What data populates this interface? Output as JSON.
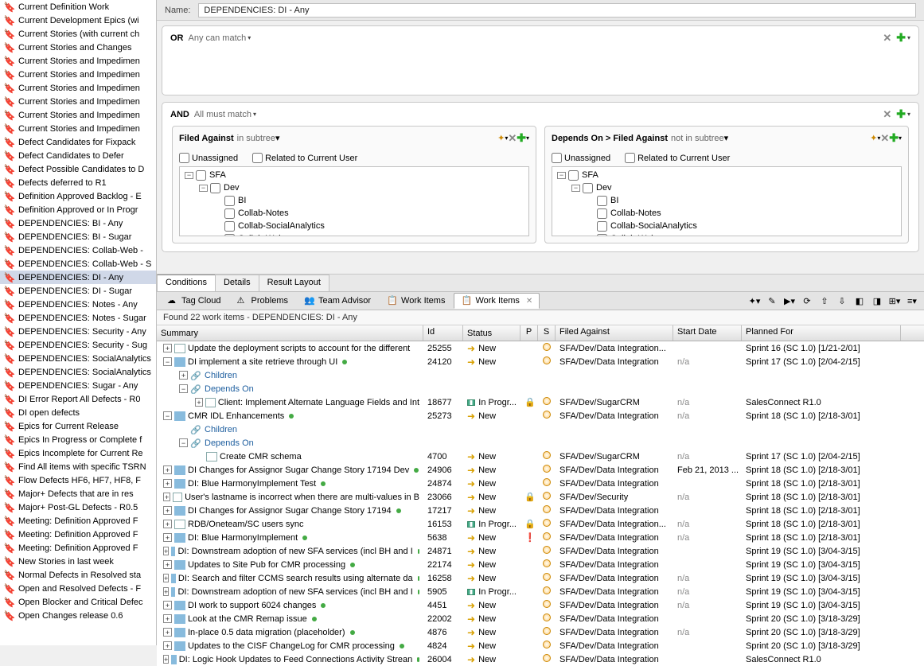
{
  "name_label": "Name:",
  "name_value": "DEPENDENCIES: DI - Any",
  "sidebar_items": [
    "Current Definition Work",
    "Current Development Epics (wi",
    "Current Stories (with current ch",
    "Current Stories and Changes",
    "Current Stories and Impedimen",
    "Current Stories and Impedimen",
    "Current Stories and Impedimen",
    "Current Stories and Impedimen",
    "Current Stories and Impedimen",
    "Current Stories and Impedimen",
    "Defect Candidates for Fixpack",
    "Defect Candidates to Defer",
    "Defect Possible Candidates to D",
    "Defects deferred to R1",
    "Definition Approved Backlog - E",
    "Definition Approved or In Progr",
    "DEPENDENCIES: BI - Any",
    "DEPENDENCIES: BI - Sugar",
    "DEPENDENCIES: Collab-Web - ",
    "DEPENDENCIES: Collab-Web - S",
    "DEPENDENCIES: DI - Any",
    "DEPENDENCIES: DI - Sugar",
    "DEPENDENCIES: Notes - Any",
    "DEPENDENCIES: Notes - Sugar",
    "DEPENDENCIES: Security - Any",
    "DEPENDENCIES: Security - Sug",
    "DEPENDENCIES: SocialAnalytics",
    "DEPENDENCIES: SocialAnalytics",
    "DEPENDENCIES: Sugar - Any",
    "DI Error Report All Defects - R0",
    "DI open defects",
    "Epics for Current Release",
    "Epics In Progress or Complete f",
    "Epics Incomplete for Current Re",
    "Find All items with specific TSRN",
    "Flow Defects HF6, HF7, HF8, F",
    "Major+ Defects  that are in res",
    "Major+ Post-GL Defects - R0.5",
    "Meeting:  Definition Approved F",
    "Meeting:  Definition Approved F",
    "Meeting:  Definition Approved F",
    "New Stories in last week",
    "Normal Defects in Resolved sta",
    "Open and Resolved Defects - F",
    "Open Blocker and Critical Defec",
    "Open Changes release 0.6"
  ],
  "sidebar_selected_index": 20,
  "or_block": {
    "label": "OR",
    "sub": "Any can match"
  },
  "and_block": {
    "label": "AND",
    "sub": "All must match"
  },
  "filters": [
    {
      "name": "Filed Against",
      "type": "in subtree",
      "unassigned_label": "Unassigned",
      "related_label": "Related to Current User",
      "tree": [
        "SFA",
        "Dev",
        "BI",
        "Collab-Notes",
        "Collab-SocialAnalytics",
        "Collab-Web"
      ]
    },
    {
      "name": "Depends On > Filed Against",
      "type": "not in subtree",
      "unassigned_label": "Unassigned",
      "related_label": "Related to Current User",
      "tree": [
        "SFA",
        "Dev",
        "BI",
        "Collab-Notes",
        "Collab-SocialAnalytics",
        "Collab-Web"
      ]
    }
  ],
  "bottom_tabs": [
    "Conditions",
    "Details",
    "Result Layout"
  ],
  "bottom_tab_active": 0,
  "views": [
    "Tag Cloud",
    "Problems",
    "Team Advisor",
    "Work Items",
    "Work Items"
  ],
  "view_active": 4,
  "result_status": "Found 22 work items - DEPENDENCIES: DI - Any",
  "columns": [
    "Summary",
    "Id",
    "Status",
    "P",
    "S",
    "Filed Against",
    "Start Date",
    "Planned For"
  ],
  "rows": [
    {
      "exp": "+",
      "ind": 0,
      "ico": "doc",
      "summary": "Update the deployment scripts to account for the different",
      "id": "25255",
      "status": "New",
      "stico": "new",
      "p": "",
      "s": "circ",
      "filed": "SFA/Dev/Data Integration...",
      "start": "",
      "planned": "Sprint 16 (SC 1.0) [1/21-2/01]"
    },
    {
      "exp": "-",
      "ind": 0,
      "ico": "story",
      "summary": "DI implement a site retrieve through UI",
      "id": "24120",
      "status": "New",
      "stico": "new",
      "p": "",
      "s": "circ",
      "filed": "SFA/Dev/Data Integration",
      "start": "n/a",
      "planned": "Sprint 17 (SC 1.0) [2/04-2/15]"
    },
    {
      "exp": "+",
      "ind": 1,
      "child": "Children"
    },
    {
      "exp": "-",
      "ind": 1,
      "child": "Depends On"
    },
    {
      "exp": "+",
      "ind": 2,
      "ico": "doc",
      "summary": "Client: Implement Alternate Language Fields and Int",
      "id": "18677",
      "status": "In Progr...",
      "stico": "prog",
      "p": "lock",
      "s": "circ",
      "filed": "SFA/Dev/SugarCRM",
      "start": "n/a",
      "planned": "SalesConnect R1.0"
    },
    {
      "exp": "-",
      "ind": 0,
      "ico": "story",
      "summary": "CMR IDL Enhancements",
      "id": "25273",
      "status": "New",
      "stico": "new",
      "p": "",
      "s": "circ",
      "filed": "SFA/Dev/Data Integration",
      "start": "n/a",
      "planned": "Sprint 18 (SC 1.0) [2/18-3/01]"
    },
    {
      "exp": "",
      "ind": 1,
      "child": "Children"
    },
    {
      "exp": "-",
      "ind": 1,
      "child": "Depends On"
    },
    {
      "exp": "",
      "ind": 2,
      "ico": "doc",
      "summary": "Create CMR schema",
      "id": "4700",
      "status": "New",
      "stico": "new",
      "p": "",
      "s": "circ",
      "filed": "SFA/Dev/SugarCRM",
      "start": "n/a",
      "planned": "Sprint 17 (SC 1.0) [2/04-2/15]"
    },
    {
      "exp": "+",
      "ind": 0,
      "ico": "story",
      "summary": "DI Changes for Assignor Sugar Change Story 17194 Dev",
      "id": "24906",
      "status": "New",
      "stico": "new",
      "p": "",
      "s": "circ",
      "filed": "SFA/Dev/Data Integration",
      "start": "Feb 21, 2013 ...",
      "planned": "Sprint 18 (SC 1.0) [2/18-3/01]"
    },
    {
      "exp": "+",
      "ind": 0,
      "ico": "story",
      "summary": "DI: Blue HarmonyImplement Test",
      "id": "24874",
      "status": "New",
      "stico": "new",
      "p": "",
      "s": "circ",
      "filed": "SFA/Dev/Data Integration",
      "start": "",
      "planned": "Sprint 18 (SC 1.0) [2/18-3/01]"
    },
    {
      "exp": "+",
      "ind": 0,
      "ico": "doc",
      "summary": "User's lastname is incorrect when there are multi-values in B",
      "id": "23066",
      "status": "New",
      "stico": "new",
      "p": "lock",
      "s": "circ",
      "filed": "SFA/Dev/Security",
      "start": "n/a",
      "planned": "Sprint 18 (SC 1.0) [2/18-3/01]"
    },
    {
      "exp": "+",
      "ind": 0,
      "ico": "story",
      "summary": "DI Changes for Assignor Sugar Change Story 17194",
      "id": "17217",
      "status": "New",
      "stico": "new",
      "p": "",
      "s": "circ",
      "filed": "SFA/Dev/Data Integration",
      "start": "",
      "planned": "Sprint 18 (SC 1.0) [2/18-3/01]"
    },
    {
      "exp": "+",
      "ind": 0,
      "ico": "doc",
      "summary": "RDB/Oneteam/SC users sync",
      "id": "16153",
      "status": "In Progr...",
      "stico": "prog",
      "p": "lock",
      "s": "circ",
      "filed": "SFA/Dev/Data Integration...",
      "start": "n/a",
      "planned": "Sprint 18 (SC 1.0) [2/18-3/01]"
    },
    {
      "exp": "+",
      "ind": 0,
      "ico": "story",
      "summary": "DI: Blue HarmonyImplement",
      "id": "5638",
      "status": "New",
      "stico": "new",
      "p": "red",
      "s": "circ",
      "filed": "SFA/Dev/Data Integration",
      "start": "n/a",
      "planned": "Sprint 18 (SC 1.0) [2/18-3/01]"
    },
    {
      "exp": "+",
      "ind": 0,
      "ico": "story",
      "summary": "DI: Downstream adoption of new SFA services (incl BH and I",
      "id": "24871",
      "status": "New",
      "stico": "new",
      "p": "",
      "s": "circ",
      "filed": "SFA/Dev/Data Integration",
      "start": "",
      "planned": "Sprint 19 (SC 1.0) [3/04-3/15]"
    },
    {
      "exp": "+",
      "ind": 0,
      "ico": "story",
      "summary": "Updates to Site Pub for CMR processing",
      "id": "22174",
      "status": "New",
      "stico": "new",
      "p": "",
      "s": "circ",
      "filed": "SFA/Dev/Data Integration",
      "start": "",
      "planned": "Sprint 19 (SC 1.0) [3/04-3/15]"
    },
    {
      "exp": "+",
      "ind": 0,
      "ico": "story",
      "summary": "DI: Search and filter CCMS search results using alternate da",
      "id": "16258",
      "status": "New",
      "stico": "new",
      "p": "",
      "s": "circ",
      "filed": "SFA/Dev/Data Integration",
      "start": "n/a",
      "planned": "Sprint 19 (SC 1.0) [3/04-3/15]"
    },
    {
      "exp": "+",
      "ind": 0,
      "ico": "story",
      "summary": "DI: Downstream adoption of new SFA services (incl BH and I",
      "id": "5905",
      "status": "In Progr...",
      "stico": "prog",
      "p": "",
      "s": "circ",
      "filed": "SFA/Dev/Data Integration",
      "start": "n/a",
      "planned": "Sprint 19 (SC 1.0) [3/04-3/15]"
    },
    {
      "exp": "+",
      "ind": 0,
      "ico": "story",
      "summary": "DI work to support 6024 changes",
      "id": "4451",
      "status": "New",
      "stico": "new",
      "p": "",
      "s": "circ",
      "filed": "SFA/Dev/Data Integration",
      "start": "n/a",
      "planned": "Sprint 19 (SC 1.0) [3/04-3/15]"
    },
    {
      "exp": "+",
      "ind": 0,
      "ico": "story",
      "summary": "Look at the CMR Remap issue",
      "id": "22002",
      "status": "New",
      "stico": "new",
      "p": "",
      "s": "circ",
      "filed": "SFA/Dev/Data Integration",
      "start": "",
      "planned": "Sprint 20 (SC 1.0) [3/18-3/29]"
    },
    {
      "exp": "+",
      "ind": 0,
      "ico": "story",
      "summary": "In-place 0.5 data migration (placeholder)",
      "id": "4876",
      "status": "New",
      "stico": "new",
      "p": "",
      "s": "circ",
      "filed": "SFA/Dev/Data Integration",
      "start": "n/a",
      "planned": "Sprint 20 (SC 1.0) [3/18-3/29]"
    },
    {
      "exp": "+",
      "ind": 0,
      "ico": "story",
      "summary": "Updates to the CISF ChangeLog for CMR processing",
      "id": "4824",
      "status": "New",
      "stico": "new",
      "p": "",
      "s": "circ",
      "filed": "SFA/Dev/Data Integration",
      "start": "",
      "planned": "Sprint 20 (SC 1.0) [3/18-3/29]"
    },
    {
      "exp": "+",
      "ind": 0,
      "ico": "story",
      "summary": "DI: Logic Hook Updates to Feed Connections Activity Strean",
      "id": "26004",
      "status": "New",
      "stico": "new",
      "p": "",
      "s": "circ",
      "filed": "SFA/Dev/Data Integration",
      "start": "",
      "planned": "SalesConnect R1.0"
    }
  ]
}
